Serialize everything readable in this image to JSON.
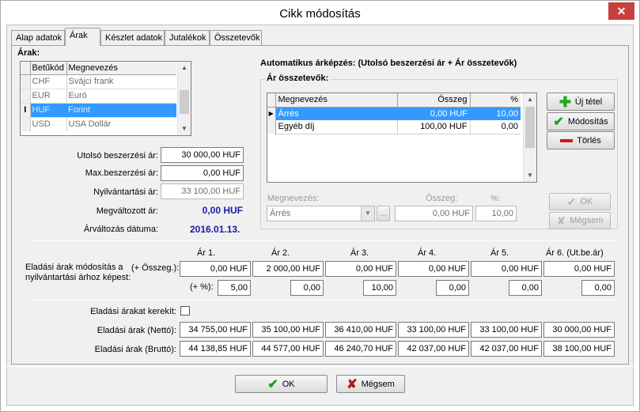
{
  "window": {
    "title": "Cikk módosítás",
    "close": "✕"
  },
  "tabs": [
    "Alap adatok",
    "Árak",
    "Készlet adatok",
    "Jutalékok",
    "Összetevők"
  ],
  "prices_label": "Árak:",
  "currency_grid": {
    "headers": [
      "Betűkód",
      "Megnevezés"
    ],
    "rows": [
      {
        "code": "CHF",
        "name": "Svájci frank"
      },
      {
        "code": "EUR",
        "name": "Euró"
      },
      {
        "code": "HUF",
        "name": "Forint"
      },
      {
        "code": "USD",
        "name": "USA Dollár"
      }
    ],
    "cursor": "I"
  },
  "fields": {
    "last_purchase_label": "Utolsó beszerzési ár:",
    "last_purchase": "30 000,00 HUF",
    "max_purchase_label": "Max.beszerzési ár:",
    "max_purchase": "0,00 HUF",
    "registry_label": "Nyilvántartási ár:",
    "registry": "33 100,00 HUF",
    "changed_label": "Megváltozott ár:",
    "changed": "0,00 HUF",
    "change_date_label": "Árváltozás dátuma:",
    "change_date": "2016.01.13."
  },
  "auto_pricing": {
    "title": "Automatikus árképzés: (Utolsó beszerzési ár + Ár összetevők)",
    "group_label": "Ár összetevők:",
    "headers": [
      "Megnevezés",
      "Összeg",
      "%"
    ],
    "rows": [
      {
        "name": "Árrés",
        "amount": "0,00 HUF",
        "pct": "10,00"
      },
      {
        "name": "Egyéb díj",
        "amount": "100,00 HUF",
        "pct": "0,00"
      }
    ],
    "new_button": "Új tétel",
    "modify_button": "Módosítás",
    "delete_button": "Törlés",
    "edit_name_label": "Megnevezés:",
    "edit_name_value": "Árrés",
    "edit_amount_label": "Összeg:",
    "edit_amount_value": "0,00 HUF",
    "edit_pct_label": "%:",
    "edit_pct_value": "10,00",
    "ellipsis": "...",
    "ok_button": "OK",
    "cancel_button": "Mégsem"
  },
  "selling": {
    "columns": [
      "Ár 1.",
      "Ár 2.",
      "Ár 3.",
      "Ár 4.",
      "Ár 5.",
      "Ár 6. (Ut.be.ár)"
    ],
    "modify_label": "Eladási árak módosítás a nyilvántartási árhoz képest:",
    "amount_label": "(+ Összeg.):",
    "pct_label": "(+ %):",
    "amounts": [
      "0,00 HUF",
      "2 000,00 HUF",
      "0,00 HUF",
      "0,00 HUF",
      "0,00 HUF",
      "0,00 HUF"
    ],
    "pcts": [
      "5,00",
      "0,00",
      "10,00",
      "0,00",
      "0,00",
      "0,00"
    ],
    "round_label": "Eladási árakat kerekít:",
    "net_label": "Eladási árak (Nettó):",
    "net": [
      "34 755,00 HUF",
      "35 100,00 HUF",
      "36 410,00 HUF",
      "33 100,00 HUF",
      "33 100,00 HUF",
      "30 000,00 HUF"
    ],
    "gross_label": "Eladási árak (Bruttó):",
    "gross": [
      "44 138,85 HUF",
      "44 577,00 HUF",
      "46 240,70 HUF",
      "42 037,00 HUF",
      "42 037,00 HUF",
      "38 100,00 HUF"
    ]
  },
  "footer": {
    "ok_button": "OK",
    "cancel_button": "Mégsem"
  },
  "colors": {
    "selection": "#3399ff",
    "plus": "#22a822",
    "check": "#1f9a1f",
    "minus": "#d01818",
    "cancel_x": "#b01818"
  }
}
